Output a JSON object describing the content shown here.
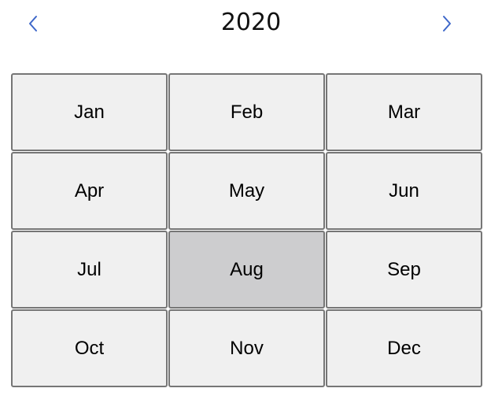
{
  "header": {
    "year": "2020",
    "prev_icon": "chevron-left-icon",
    "next_icon": "chevron-right-icon"
  },
  "colors": {
    "nav_accent": "#3d67c9",
    "cell_bg": "#f0f0f0",
    "cell_selected_bg": "#cdcdcf",
    "cell_border": "#767676"
  },
  "months": [
    {
      "label": "Jan",
      "selected": false
    },
    {
      "label": "Feb",
      "selected": false
    },
    {
      "label": "Mar",
      "selected": false
    },
    {
      "label": "Apr",
      "selected": false
    },
    {
      "label": "May",
      "selected": false
    },
    {
      "label": "Jun",
      "selected": false
    },
    {
      "label": "Jul",
      "selected": false
    },
    {
      "label": "Aug",
      "selected": true
    },
    {
      "label": "Sep",
      "selected": false
    },
    {
      "label": "Oct",
      "selected": false
    },
    {
      "label": "Nov",
      "selected": false
    },
    {
      "label": "Dec",
      "selected": false
    }
  ]
}
